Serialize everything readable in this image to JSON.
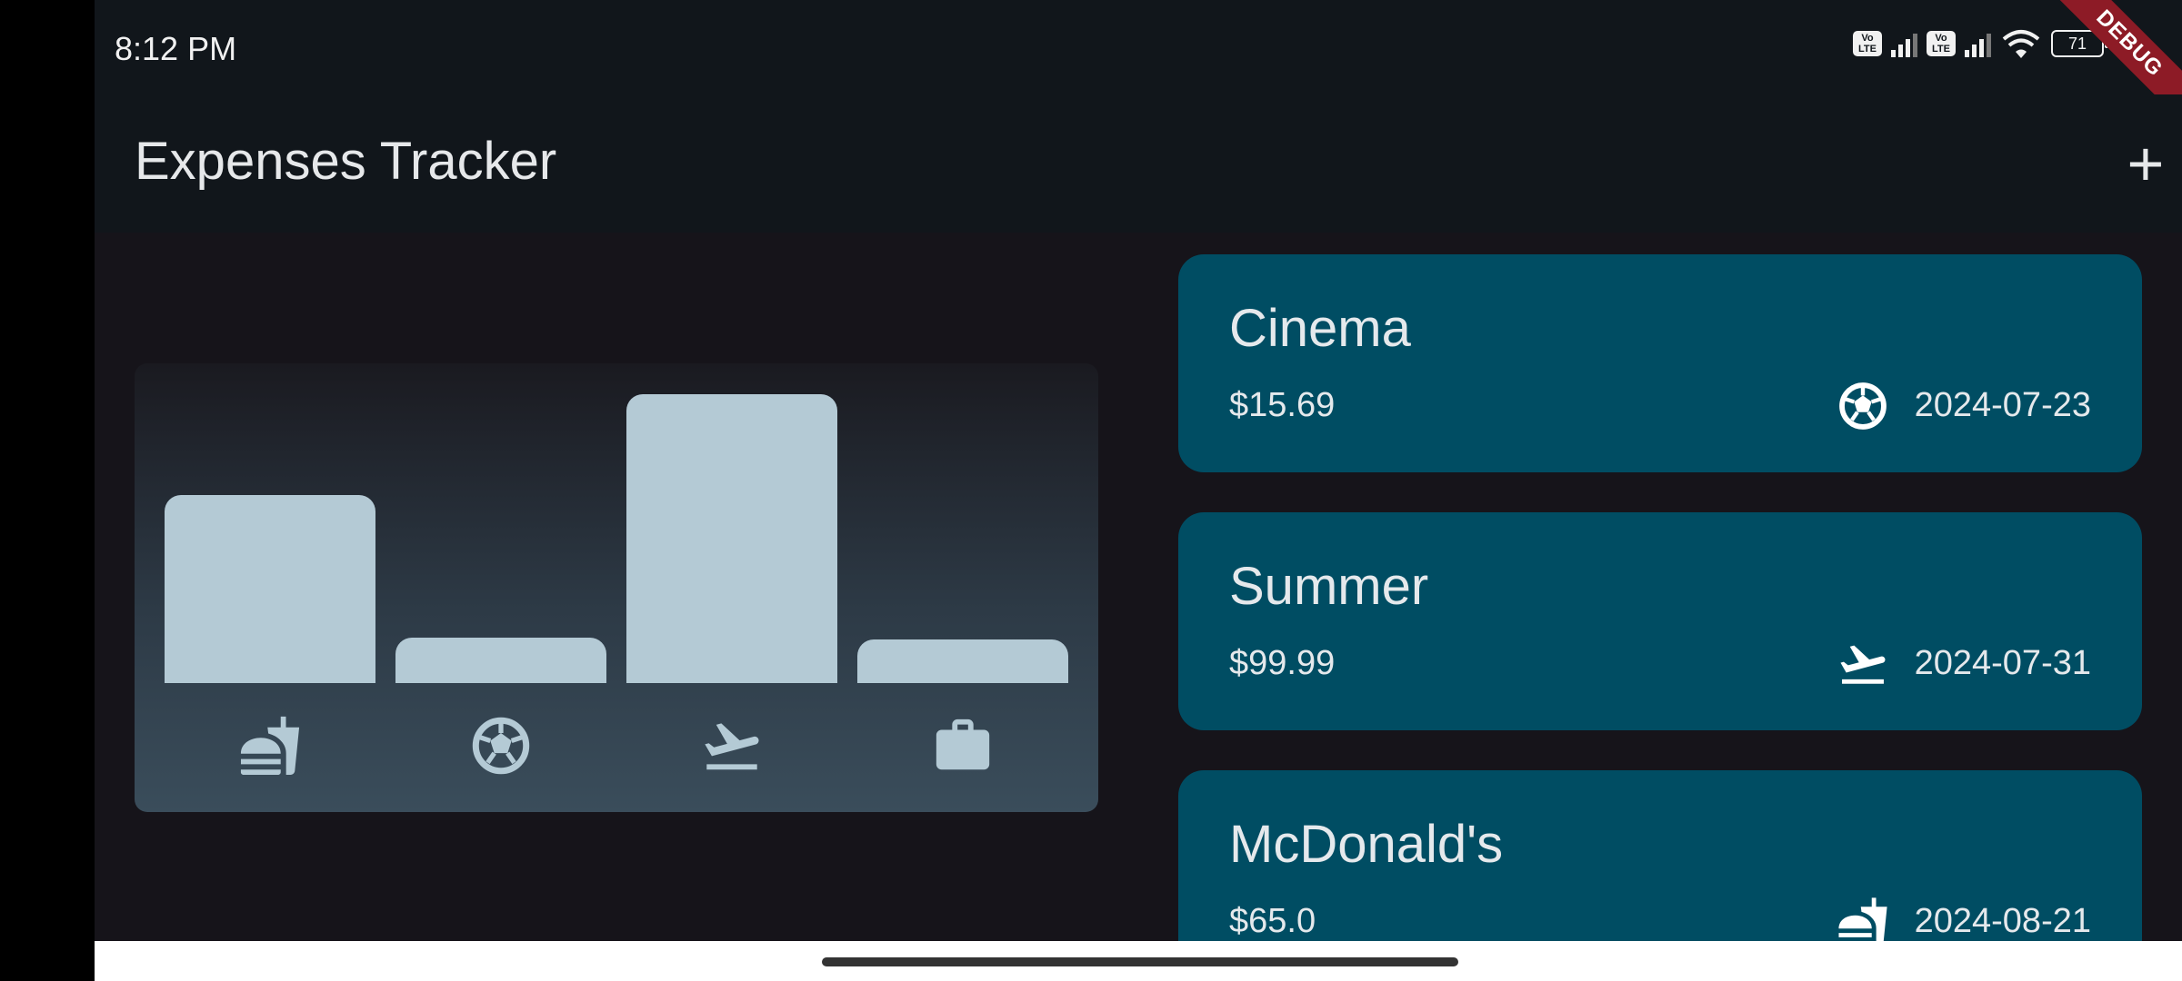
{
  "status": {
    "time": "8:12 PM",
    "volte": "Vo\nLTE",
    "battery": "71"
  },
  "debug_banner": "DEBUG",
  "appbar": {
    "title": "Expenses Tracker",
    "add_label": "+"
  },
  "chart_data": {
    "type": "bar",
    "categories": [
      "food",
      "leisure",
      "travel",
      "work"
    ],
    "category_icons": [
      "fastfood-icon",
      "soccer-ball-icon",
      "flight-takeoff-icon",
      "briefcase-icon"
    ],
    "values": [
      65.0,
      15.69,
      99.99,
      15.0
    ],
    "ylim": [
      0,
      99.99
    ],
    "bar_color": "#b4cad5"
  },
  "expenses": [
    {
      "title": "Cinema",
      "amount": "$15.69",
      "date": "2024-07-23",
      "icon": "soccer-ball-icon"
    },
    {
      "title": "Summer",
      "amount": "$99.99",
      "date": "2024-07-31",
      "icon": "flight-takeoff-icon"
    },
    {
      "title": "McDonald's",
      "amount": "$65.0",
      "date": "2024-08-21",
      "icon": "fastfood-icon"
    }
  ],
  "colors": {
    "card": "#004d63",
    "background": "#16141a",
    "appbar": "#11161b",
    "accent_bar": "#b4cad5"
  }
}
